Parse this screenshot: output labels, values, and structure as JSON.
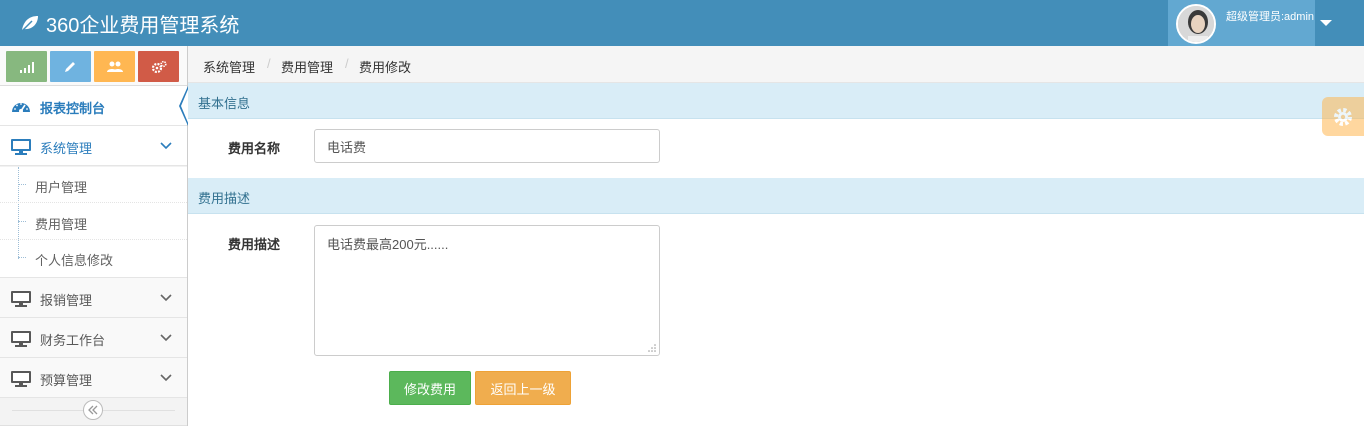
{
  "app": {
    "title": "360企业费用管理系统"
  },
  "user": {
    "name": "超级管理员:admin"
  },
  "shortcuts": [
    {
      "icon": "signal-icon",
      "color": "#87b87f"
    },
    {
      "icon": "pencil-icon",
      "color": "#6fb3e0"
    },
    {
      "icon": "users-icon",
      "color": "#ffb752"
    },
    {
      "icon": "cogs-icon",
      "color": "#d15b47"
    }
  ],
  "sidebar": {
    "items": [
      {
        "label": "报表控制台",
        "icon": "dashboard-icon",
        "active": true
      },
      {
        "label": "系统管理",
        "icon": "desktop-icon",
        "expanded": true
      },
      {
        "label": "报销管理",
        "icon": "desktop-icon"
      },
      {
        "label": "财务工作台",
        "icon": "desktop-icon"
      },
      {
        "label": "预算管理",
        "icon": "desktop-icon"
      }
    ],
    "submenu": [
      {
        "label": "用户管理"
      },
      {
        "label": "费用管理"
      },
      {
        "label": "个人信息修改"
      }
    ]
  },
  "breadcrumbs": [
    "系统管理",
    "费用管理",
    "费用修改"
  ],
  "form": {
    "section_basic": "基本信息",
    "name_label": "费用名称",
    "name_value": "电话费",
    "section_desc": "费用描述",
    "desc_label": "费用描述",
    "desc_value": "电话费最高200元......",
    "save_button": "修改费用",
    "back_button": "返回上一级"
  },
  "colors": {
    "navbar": "#438eb9",
    "accent": "#2b7dbc",
    "success": "#5cb85c",
    "warning": "#f0ad4e",
    "section_bg": "#d9edf7"
  }
}
